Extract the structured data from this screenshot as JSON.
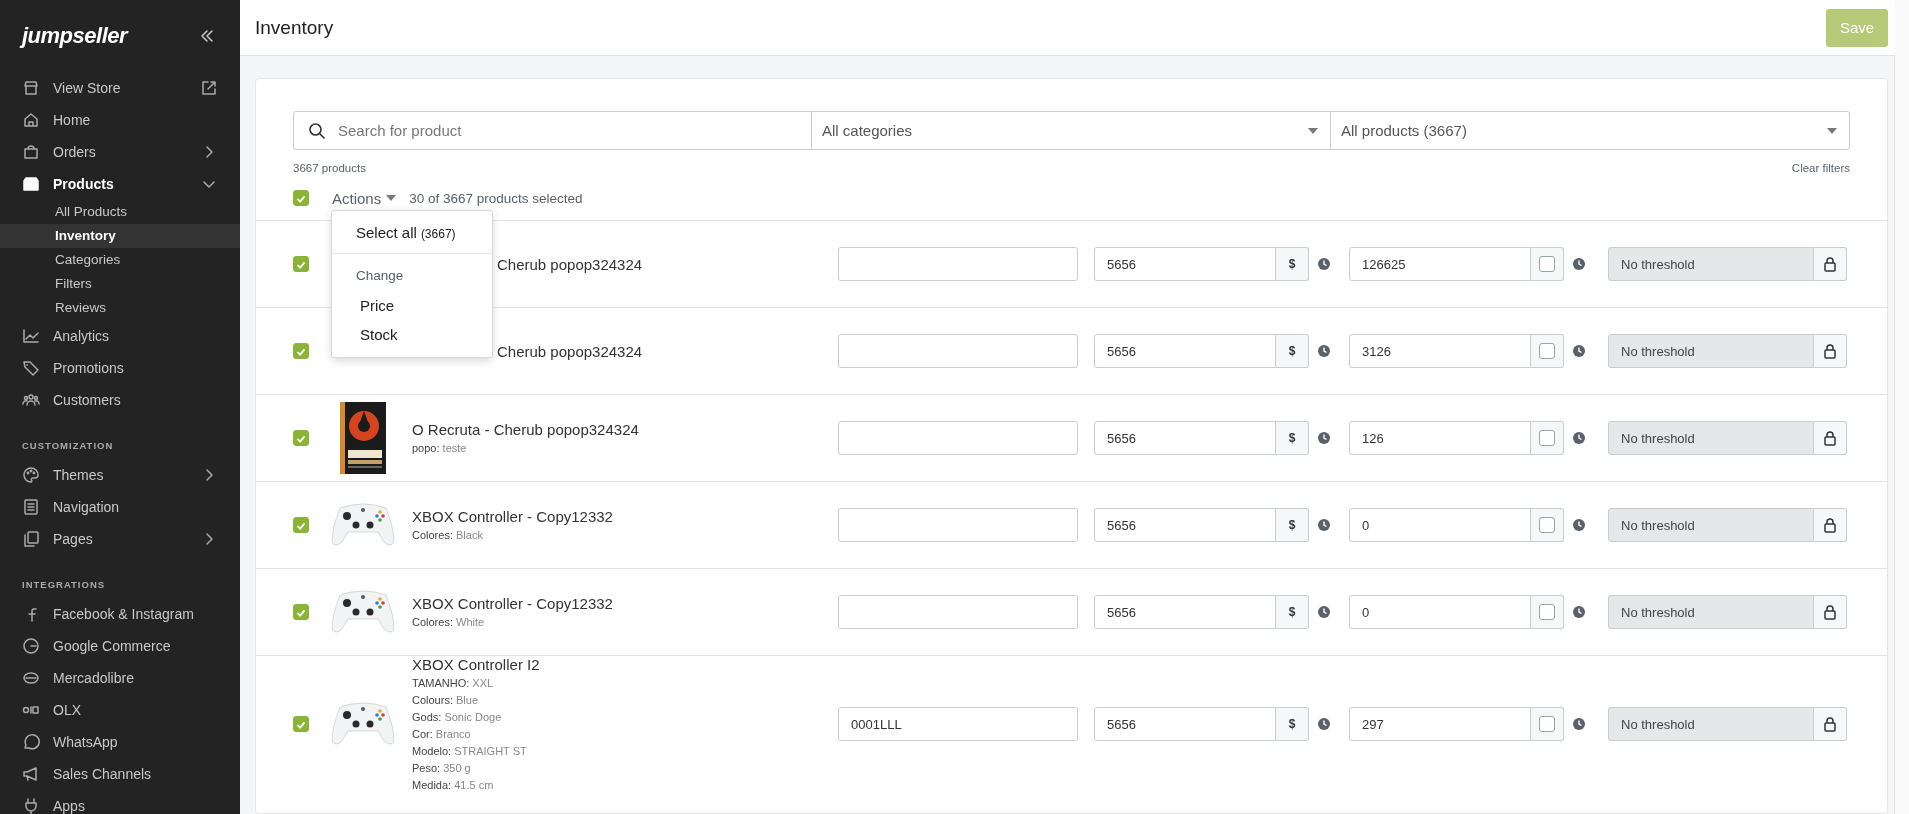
{
  "sidebar": {
    "logo": "jumpseller",
    "sections": [
      {
        "items": [
          {
            "label": "View Store",
            "selected": false,
            "external": true
          },
          {
            "label": "Home",
            "selected": false
          },
          {
            "label": "Orders",
            "selected": false,
            "expanded": false
          },
          {
            "label": "Products",
            "selected": true,
            "expanded": true,
            "children": [
              {
                "label": "All Products",
                "selected": false
              },
              {
                "label": "Inventory",
                "selected": true
              },
              {
                "label": "Categories",
                "selected": false
              },
              {
                "label": "Filters",
                "selected": false
              },
              {
                "label": "Reviews",
                "selected": false
              }
            ]
          },
          {
            "label": "Analytics",
            "selected": false
          },
          {
            "label": "Promotions",
            "selected": false
          },
          {
            "label": "Customers",
            "selected": false
          }
        ]
      },
      {
        "heading": "CUSTOMIZATION",
        "items": [
          {
            "label": "Themes",
            "selected": false,
            "expanded": false
          },
          {
            "label": "Navigation",
            "selected": false
          },
          {
            "label": "Pages",
            "selected": false,
            "expanded": false
          }
        ]
      },
      {
        "heading": "INTEGRATIONS",
        "items": [
          {
            "label": "Facebook & Instagram",
            "selected": false
          },
          {
            "label": "Google Commerce",
            "selected": false
          },
          {
            "label": "Mercadolibre",
            "selected": false
          },
          {
            "label": "OLX",
            "selected": false
          },
          {
            "label": "WhatsApp",
            "selected": false
          },
          {
            "label": "Sales Channels",
            "selected": false
          },
          {
            "label": "Apps",
            "selected": false
          }
        ]
      }
    ]
  },
  "header": {
    "title": "Inventory",
    "save_button": {
      "label": "Save",
      "disabled": true
    }
  },
  "filters": {
    "search": {
      "placeholder": "Search for product"
    },
    "category": "All categories",
    "products": "All products (3667)",
    "count": "3667 products",
    "clear": "Clear filters"
  },
  "bulk": {
    "checked": true,
    "actions": "Actions",
    "selection": "30 of 3667 products selected"
  },
  "actions_menu": {
    "select_all": "Select all",
    "select_all_count": "(3667)",
    "heading": "Change",
    "items": [
      "Price",
      "Stock"
    ]
  },
  "rows": [
    {
      "checked": true,
      "name": "Cherub popop324324",
      "price": "5656",
      "currency": "$",
      "stock": "126625",
      "unlimited": false,
      "threshold": "No threshold"
    },
    {
      "checked": true,
      "name": "Cherub popop324324",
      "price": "5656",
      "currency": "$",
      "stock": "3126",
      "unlimited": false,
      "threshold": "No threshold"
    },
    {
      "checked": true,
      "picture": {
        "kind": "picture"
      },
      "name": "O Recruta - Cherub popop324324",
      "options": [
        {
          "label": "popo:",
          "value": "teste"
        }
      ],
      "price": "5656",
      "currency": "$",
      "stock": "126",
      "unlimited": false,
      "threshold": "No threshold"
    },
    {
      "checked": true,
      "picture": {
        "kind": "picture"
      },
      "name": "XBOX Controller - Copy12332",
      "options": [
        {
          "label": "Colores:",
          "value": "Black"
        }
      ],
      "price": "5656",
      "currency": "$",
      "stock": "0",
      "unlimited": false,
      "threshold": "No threshold"
    },
    {
      "checked": true,
      "picture": {
        "kind": "picture"
      },
      "name": "XBOX Controller - Copy12332",
      "options": [
        {
          "label": "Colores:",
          "value": "White"
        }
      ],
      "price": "5656",
      "currency": "$",
      "stock": "0",
      "unlimited": false,
      "threshold": "No threshold"
    },
    {
      "checked": true,
      "picture": {
        "kind": "picture"
      },
      "name": "XBOX Controller  I2",
      "options": [
        {
          "label": "TAMANHO:",
          "value": "XXL"
        },
        {
          "label": "Colours:",
          "value": "Blue"
        },
        {
          "label": "Gods:",
          "value": "Sonic Doge"
        },
        {
          "label": "Cor:",
          "value": "Branco"
        },
        {
          "label": "Modelo:",
          "value": "STRAIGHT ST"
        },
        {
          "label": "Peso:",
          "value": "350 g"
        },
        {
          "label": "Medida:",
          "value": "41.5 cm"
        }
      ],
      "sku": "0001LLL",
      "price": "5656",
      "currency": "$",
      "stock": "297",
      "unlimited": false,
      "threshold": "No threshold"
    }
  ]
}
